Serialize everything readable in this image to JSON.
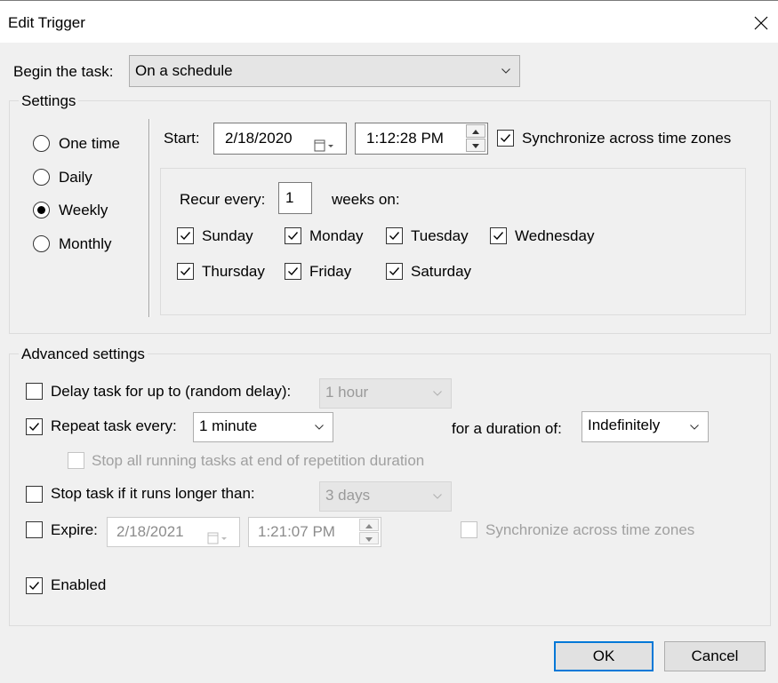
{
  "window": {
    "title": "Edit Trigger"
  },
  "begin": {
    "label": "Begin the task:",
    "value": "On a schedule"
  },
  "settings": {
    "caption": "Settings",
    "radios": [
      {
        "label": "One time",
        "checked": false
      },
      {
        "label": "Daily",
        "checked": false
      },
      {
        "label": "Weekly",
        "checked": true
      },
      {
        "label": "Monthly",
        "checked": false
      }
    ],
    "start_label": "Start:",
    "start_date": "2/18/2020",
    "start_time": "1:12:28 PM",
    "sync_label": "Synchronize across time zones",
    "sync_checked": true,
    "recur_label": "Recur every:",
    "recur_value": "1",
    "weeks_on_label": "weeks on:",
    "days": [
      {
        "label": "Sunday",
        "checked": true
      },
      {
        "label": "Monday",
        "checked": true
      },
      {
        "label": "Tuesday",
        "checked": true
      },
      {
        "label": "Wednesday",
        "checked": true
      },
      {
        "label": "Thursday",
        "checked": true
      },
      {
        "label": "Friday",
        "checked": true
      },
      {
        "label": "Saturday",
        "checked": true
      }
    ]
  },
  "advanced": {
    "caption": "Advanced settings",
    "delay_label": "Delay task for up to (random delay):",
    "delay_checked": false,
    "delay_value": "1 hour",
    "repeat_label": "Repeat task every:",
    "repeat_checked": true,
    "repeat_value": "1 minute",
    "duration_label": "for a duration of:",
    "duration_value": "Indefinitely",
    "stop_running_label": "Stop all running tasks at end of repetition duration",
    "stop_running_checked": false,
    "stop_longer_label": "Stop task if it runs longer than:",
    "stop_longer_checked": false,
    "stop_longer_value": "3 days",
    "expire_label": "Expire:",
    "expire_checked": false,
    "expire_date": "2/18/2021",
    "expire_time": "1:21:07 PM",
    "expire_sync_label": "Synchronize across time zones",
    "expire_sync_checked": false,
    "enabled_label": "Enabled",
    "enabled_checked": true
  },
  "buttons": {
    "ok": "OK",
    "cancel": "Cancel"
  },
  "icons": {
    "close": "close-icon",
    "chevron": "chevron-down-icon",
    "calendar": "calendar-icon",
    "spin_up": "spin-up-icon",
    "spin_down": "spin-down-icon",
    "check": "checkmark-icon"
  }
}
